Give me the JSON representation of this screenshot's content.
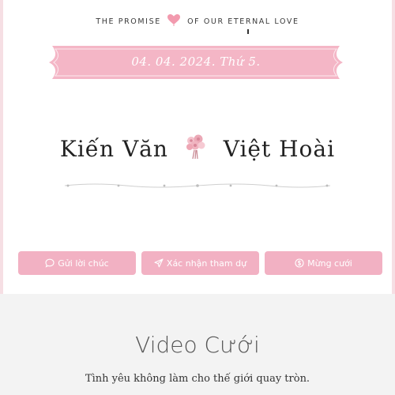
{
  "header": {
    "tagline_left": "THE PROMISE",
    "tagline_right": "OF OUR ETERNAL LOVE",
    "heart_icon": "heart-balloon-icon"
  },
  "date_banner": {
    "text": "04. 04. 2024. Thứ 5."
  },
  "couple": {
    "groom": "Kiến Văn",
    "bride": "Việt Hoài",
    "separator_icon": "bouquet-icon"
  },
  "actions": [
    {
      "label": "Gửi lời chúc",
      "icon": "chat-bubble-icon"
    },
    {
      "label": "Xác nhận tham dự",
      "icon": "paper-plane-icon"
    },
    {
      "label": "Mừng cưới",
      "icon": "coin-icon"
    }
  ],
  "video_section": {
    "title": "Video Cưới",
    "subtitle": "Tình yêu không làm cho thế giới quay tròn."
  },
  "colors": {
    "accent_pink": "#f2b1c3",
    "ribbon_pink": "#f4b6c6",
    "section_bg": "#f3f3f3"
  }
}
